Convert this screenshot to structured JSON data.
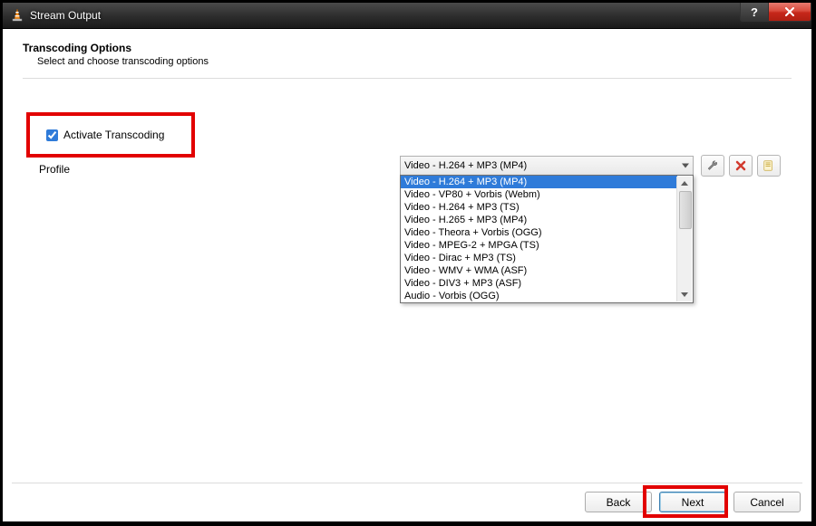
{
  "window": {
    "title": "Stream Output"
  },
  "page": {
    "heading": "Transcoding Options",
    "subheading": "Select and choose transcoding options"
  },
  "activate": {
    "label": "Activate Transcoding",
    "checked": true
  },
  "profile": {
    "label": "Profile",
    "selected": "Video - H.264 + MP3 (MP4)",
    "options": [
      "Video - H.264 + MP3 (MP4)",
      "Video - VP80 + Vorbis (Webm)",
      "Video - H.264 + MP3 (TS)",
      "Video - H.265 + MP3 (MP4)",
      "Video - Theora + Vorbis (OGG)",
      "Video - MPEG-2 + MPGA (TS)",
      "Video - Dirac + MP3 (TS)",
      "Video - WMV + WMA (ASF)",
      "Video - DIV3 + MP3 (ASF)",
      "Audio - Vorbis (OGG)"
    ]
  },
  "icons": {
    "edit": "wrench-icon",
    "delete": "delete-icon",
    "new": "new-profile-icon"
  },
  "buttons": {
    "back": "Back",
    "next": "Next",
    "cancel": "Cancel"
  },
  "colors": {
    "highlight": "#e20000",
    "selection": "#2f7bd9",
    "close": "#c6281a"
  }
}
